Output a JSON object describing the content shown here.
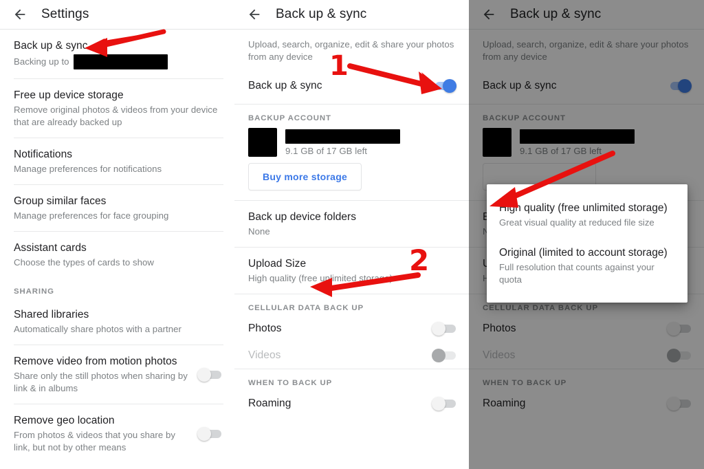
{
  "accent": {
    "red": "#e8110f",
    "blue_toggle": "#3f7ce4",
    "blue_link": "#3b78e7",
    "text_primary": "#212124",
    "text_secondary": "#7d8184"
  },
  "panel1": {
    "appbar": {
      "title": "Settings",
      "back_icon": "arrow-back-icon"
    },
    "items": [
      {
        "title": "Back up & sync",
        "sub_prefix": "Backing up to",
        "redacted": true
      },
      {
        "title": "Free up device storage",
        "sub": "Remove original photos & videos from your device that are already backed up"
      },
      {
        "title": "Notifications",
        "sub": "Manage preferences for notifications"
      },
      {
        "title": "Group similar faces",
        "sub": "Manage preferences for face grouping"
      },
      {
        "title": "Assistant cards",
        "sub": "Choose the types of cards to show"
      }
    ],
    "section_sharing": "SHARING",
    "sharing_items": [
      {
        "title": "Shared libraries",
        "sub": "Automatically share photos with a partner",
        "toggle": null
      },
      {
        "title": "Remove video from motion photos",
        "sub": "Share only the still photos when sharing by link & in albums",
        "toggle": "off"
      },
      {
        "title": "Remove geo location",
        "sub": "From photos & videos that you share by link, but not by other means",
        "toggle": "off"
      }
    ]
  },
  "panel2": {
    "appbar": {
      "title": "Back up & sync",
      "back_icon": "arrow-back-icon"
    },
    "description": "Upload, search, organize, edit & share your photos from any device",
    "backup_toggle_label": "Back up & sync",
    "backup_toggle_state": "on",
    "section_backup_account": "BACKUP ACCOUNT",
    "account_storage": "9.1 GB of 17 GB left",
    "buy_storage_label": "Buy more storage",
    "device_folders": {
      "title": "Back up device folders",
      "sub": "None"
    },
    "upload_size": {
      "title": "Upload Size",
      "sub": "High quality (free unlimited storage)"
    },
    "section_cellular": "CELLULAR DATA BACK UP",
    "cellular_items": [
      {
        "title": "Photos",
        "toggle": "off",
        "dim": false
      },
      {
        "title": "Videos",
        "toggle": "off-disabled",
        "dim": true
      }
    ],
    "section_when": "WHEN TO BACK UP",
    "when_items": [
      {
        "title": "Roaming",
        "toggle": "off",
        "dim": false
      }
    ]
  },
  "panel3": {
    "appbar": {
      "title": "Back up & sync",
      "back_icon": "arrow-back-icon"
    },
    "description": "Upload, search, organize, edit & share your photos from any device",
    "backup_toggle_label": "Back up & sync",
    "backup_toggle_state": "on",
    "section_backup_account": "BACKUP ACCOUNT",
    "account_storage": "9.1 GB of 17 GB left",
    "device_folders": {
      "title": "B",
      "sub": "N"
    },
    "upload_size": {
      "title": "Upload Size",
      "sub": "High quality (free unlimited storage)"
    },
    "section_cellular": "CELLULAR DATA BACK UP",
    "cellular_items": [
      {
        "title": "Photos",
        "toggle": "off",
        "dim": false
      },
      {
        "title": "Videos",
        "toggle": "off-disabled",
        "dim": true
      }
    ],
    "section_when": "WHEN TO BACK UP",
    "when_items": [
      {
        "title": "Roaming",
        "toggle": "off",
        "dim": false
      }
    ],
    "dialog": {
      "options": [
        {
          "title": "High quality (free unlimited storage)",
          "sub": "Great visual quality at reduced file size"
        },
        {
          "title": "Original (limited to account storage)",
          "sub": "Full resolution that counts against your quota"
        }
      ]
    }
  },
  "annotations": {
    "step1": "1",
    "step2": "2",
    "arrows": [
      "arrow-to-backup-sync-row",
      "arrow-to-backup-toggle",
      "arrow-to-upload-size",
      "arrow-to-high-quality-option"
    ]
  }
}
